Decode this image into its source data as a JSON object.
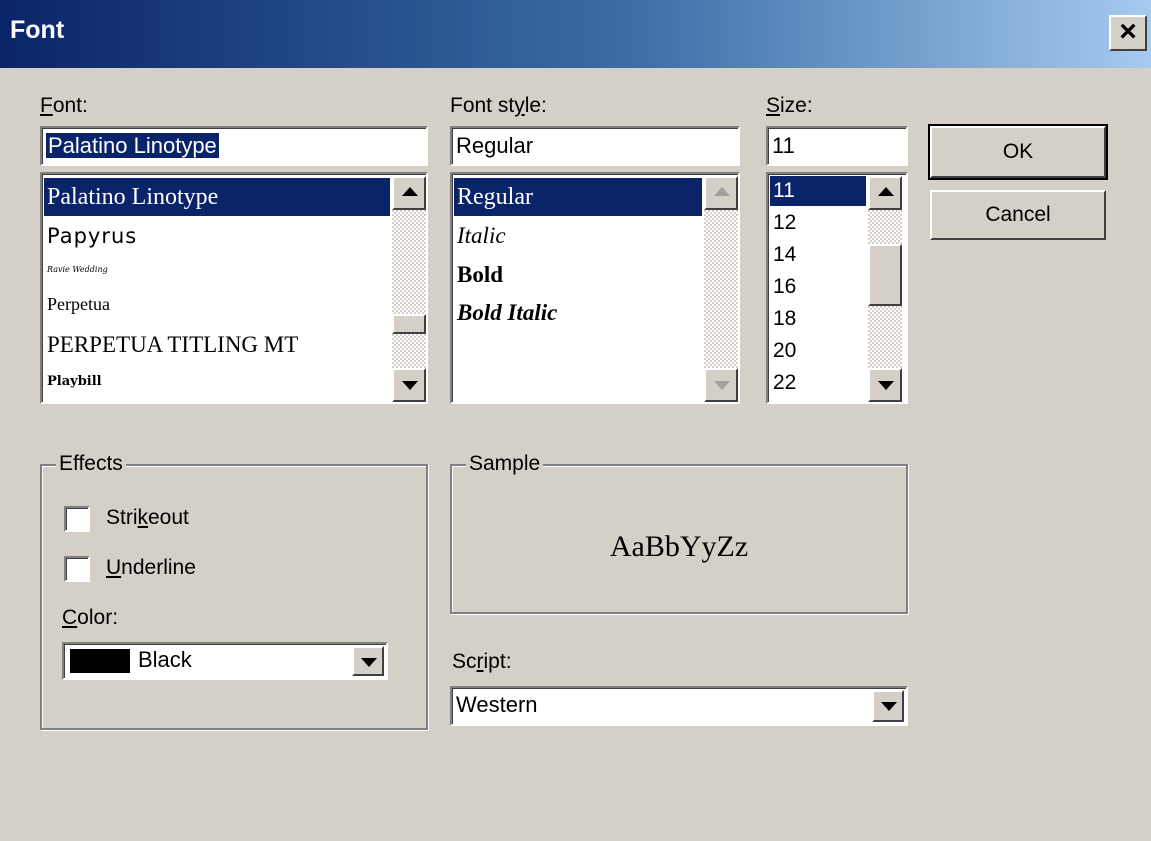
{
  "dialog": {
    "title": "Font",
    "close_label": "×"
  },
  "font": {
    "label_pre": "",
    "label_u": "F",
    "label_post": "ont:",
    "value": "Palatino Linotype",
    "items": [
      "Palatino Linotype",
      "Papyrus",
      "Ravie Wedding",
      "Perpetua",
      "PERPETUA TITLING MT",
      "Playbill"
    ],
    "selected_index": 0
  },
  "font_style": {
    "label_pre": "Font st",
    "label_u": "y",
    "label_post": "le:",
    "value": "Regular",
    "items": [
      "Regular",
      "Italic",
      "Bold",
      "Bold Italic"
    ],
    "selected_index": 0
  },
  "size": {
    "label_pre": "",
    "label_u": "S",
    "label_post": "ize:",
    "value": "11",
    "items": [
      "11",
      "12",
      "14",
      "16",
      "18",
      "20",
      "22"
    ],
    "selected_index": 0
  },
  "buttons": {
    "ok": "OK",
    "cancel": "Cancel"
  },
  "effects": {
    "title": "Effects",
    "strikeout_pre": "Stri",
    "strikeout_u": "k",
    "strikeout_post": "eout",
    "underline_pre": "",
    "underline_u": "U",
    "underline_post": "nderline",
    "strikeout_checked": false,
    "underline_checked": false,
    "color_label_pre": "",
    "color_label_u": "C",
    "color_label_post": "olor:",
    "color_value": "Black",
    "color_swatch": "#000000"
  },
  "sample": {
    "title": "Sample",
    "text": "AaBbYyZz"
  },
  "script": {
    "label_pre": "Sc",
    "label_u": "r",
    "label_post": "ipt:",
    "value": "Western"
  },
  "icons": {
    "close": "close-icon",
    "up": "arrow-up-icon",
    "down": "arrow-down-icon"
  }
}
